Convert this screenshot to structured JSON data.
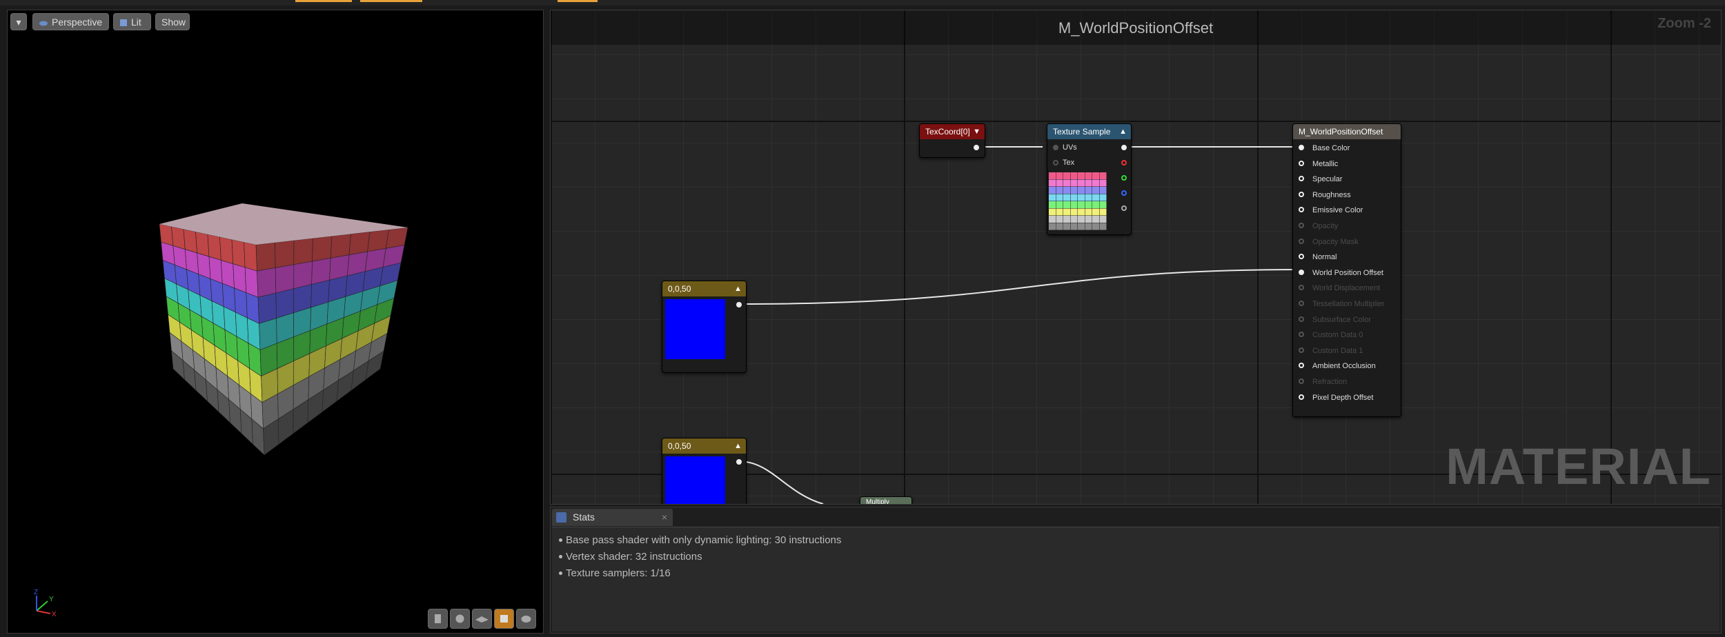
{
  "viewport": {
    "menu_button": "▾",
    "perspective_button": "Perspective",
    "lit_button": "Lit",
    "show_button": "Show",
    "axis_labels": {
      "x": "X",
      "y": "Y",
      "z": "Z"
    },
    "preview_mesh_buttons": [
      "cylinder-icon",
      "sphere-icon",
      "plane-icon",
      "cube-icon",
      "custom-mesh-icon"
    ]
  },
  "graph": {
    "title": "M_WorldPositionOffset",
    "zoom": "Zoom -2",
    "watermark": "MATERIAL",
    "nodes": {
      "texcoord": {
        "title": "TexCoord[0]",
        "color": "#7a1010"
      },
      "texture_sample": {
        "title": "Texture Sample",
        "color": "#2a5470",
        "inputs": [
          "UVs",
          "Tex"
        ]
      },
      "constant_a": {
        "title": "0,0,50",
        "color": "#6e5a18",
        "swatch": "#0000ff"
      },
      "constant_b": {
        "title": "0,0,50",
        "color": "#6e5a18",
        "swatch": "#0000ff"
      },
      "multiply": {
        "title": "Multiply"
      },
      "result": {
        "title": "M_WorldPositionOffset",
        "color": "#55504a",
        "inputs": [
          {
            "label": "Base Color",
            "active": true,
            "connected": true
          },
          {
            "label": "Metallic",
            "active": true
          },
          {
            "label": "Specular",
            "active": true
          },
          {
            "label": "Roughness",
            "active": true
          },
          {
            "label": "Emissive Color",
            "active": true
          },
          {
            "label": "Opacity",
            "active": false
          },
          {
            "label": "Opacity Mask",
            "active": false
          },
          {
            "label": "Normal",
            "active": true
          },
          {
            "label": "World Position Offset",
            "active": true,
            "connected": true
          },
          {
            "label": "World Displacement",
            "active": false
          },
          {
            "label": "Tessellation Multiplier",
            "active": false
          },
          {
            "label": "Subsurface Color",
            "active": false
          },
          {
            "label": "Custom Data 0",
            "active": false
          },
          {
            "label": "Custom Data 1",
            "active": false
          },
          {
            "label": "Ambient Occlusion",
            "active": true
          },
          {
            "label": "Refraction",
            "active": false
          },
          {
            "label": "Pixel Depth Offset",
            "active": true
          }
        ]
      }
    }
  },
  "stats": {
    "tab_label": "Stats",
    "close": "×",
    "lines": [
      "Base pass shader with only dynamic lighting: 30 instructions",
      "Vertex shader: 32 instructions",
      "Texture samplers: 1/16"
    ]
  }
}
